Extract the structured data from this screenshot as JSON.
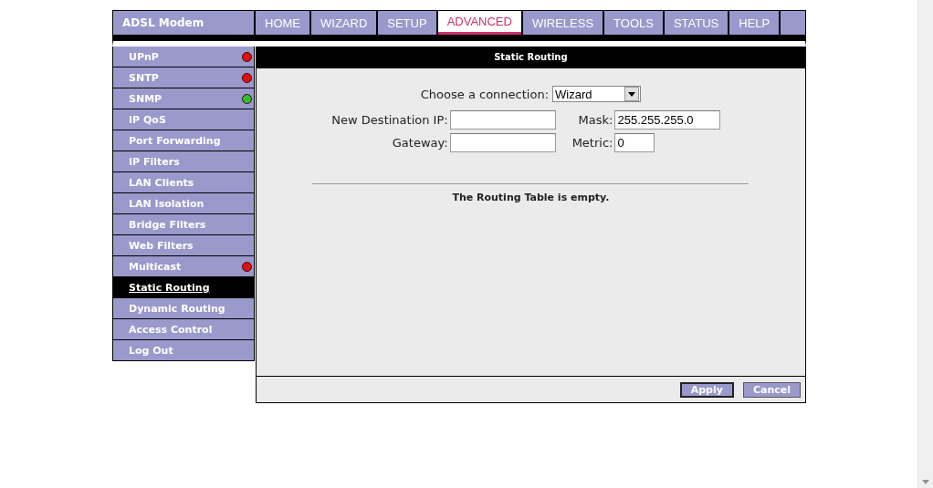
{
  "header": {
    "title": "ADSL Modem"
  },
  "tabs": [
    {
      "label": "HOME",
      "selected": false
    },
    {
      "label": "WIZARD",
      "selected": false
    },
    {
      "label": "SETUP",
      "selected": false
    },
    {
      "label": "ADVANCED",
      "selected": true
    },
    {
      "label": "WIRELESS",
      "selected": false
    },
    {
      "label": "TOOLS",
      "selected": false
    },
    {
      "label": "STATUS",
      "selected": false
    },
    {
      "label": "HELP",
      "selected": false
    }
  ],
  "sidebar": {
    "items": [
      {
        "label": "UPnP",
        "selected": false,
        "color": "#e01010"
      },
      {
        "label": "SNTP",
        "selected": false,
        "color": "#e01010"
      },
      {
        "label": "SNMP",
        "selected": false,
        "color": "#30c030"
      },
      {
        "label": "IP QoS",
        "selected": false
      },
      {
        "label": "Port Forwarding",
        "selected": false
      },
      {
        "label": "IP Filters",
        "selected": false
      },
      {
        "label": "LAN Clients",
        "selected": false
      },
      {
        "label": "LAN Isolation",
        "selected": false
      },
      {
        "label": "Bridge Filters",
        "selected": false
      },
      {
        "label": "Web Filters",
        "selected": false
      },
      {
        "label": "Multicast",
        "selected": false,
        "color": "#e01010"
      },
      {
        "label": "Static Routing",
        "selected": true
      },
      {
        "label": "Dynamic Routing",
        "selected": false
      },
      {
        "label": "Access Control",
        "selected": false
      },
      {
        "label": "Log Out",
        "selected": false
      }
    ]
  },
  "panel": {
    "title": "Static Routing",
    "connection": {
      "label": "Choose a connection:",
      "value": "Wizard"
    },
    "fields": [
      {
        "label": "New Destination IP:"
      },
      {
        "label": "Mask:",
        "value": "255.255.255.0"
      },
      {
        "label": "Gateway:"
      },
      {
        "label": "Metric:",
        "value": "0"
      }
    ],
    "message": "The Routing Table is empty.",
    "buttons": [
      {
        "label": "Apply",
        "default": true
      },
      {
        "label": "Cancel",
        "default": false
      }
    ]
  }
}
